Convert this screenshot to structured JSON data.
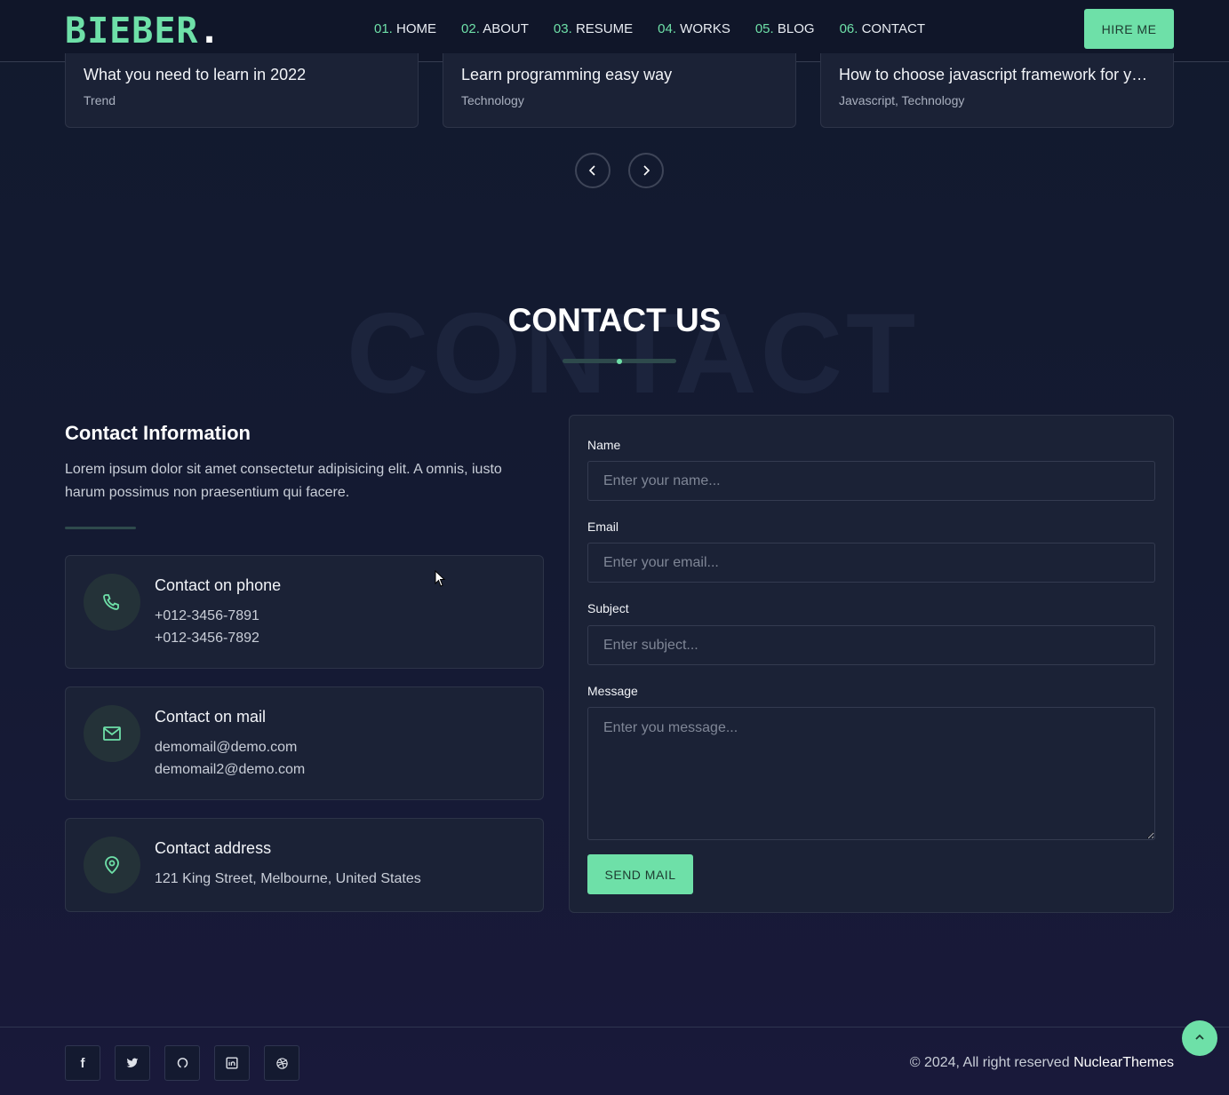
{
  "header": {
    "logo": "BIEBER",
    "logo_dot": ".",
    "nav": [
      {
        "num": "01.",
        "label": "HOME"
      },
      {
        "num": "02.",
        "label": "ABOUT"
      },
      {
        "num": "03.",
        "label": "RESUME"
      },
      {
        "num": "04.",
        "label": "WORKS"
      },
      {
        "num": "05.",
        "label": "BLOG"
      },
      {
        "num": "06.",
        "label": "CONTACT"
      }
    ],
    "hire": "HIRE ME"
  },
  "blog": [
    {
      "title": "What you need to learn in 2022",
      "tags": "Trend"
    },
    {
      "title": "Learn programming easy way",
      "tags": "Technology"
    },
    {
      "title": "How to choose javascript framework for your project",
      "tags": "Javascript,  Technology"
    }
  ],
  "contact": {
    "bg_word": "CONTACT",
    "title": "CONTACT US",
    "info_title": "Contact Information",
    "info_text": "Lorem ipsum dolor sit amet consectetur adipisicing elit. A omnis, iusto harum possimus non praesentium qui facere.",
    "cards": [
      {
        "title": "Contact on phone",
        "lines": [
          "+012-3456-7891",
          "+012-3456-7892"
        ]
      },
      {
        "title": "Contact on mail",
        "lines": [
          "demomail@demo.com",
          "demomail2@demo.com"
        ]
      },
      {
        "title": "Contact address",
        "lines": [
          "121 King Street, Melbourne, United States"
        ]
      }
    ],
    "form": {
      "name_label": "Name",
      "name_ph": "Enter your name...",
      "email_label": "Email",
      "email_ph": "Enter your email...",
      "subject_label": "Subject",
      "subject_ph": "Enter subject...",
      "message_label": "Message",
      "message_ph": "Enter you message...",
      "send": "SEND MAIL"
    }
  },
  "footer": {
    "copy": "© 2024, All right reserved",
    "brand": "NuclearThemes",
    "social": [
      "facebook",
      "twitter",
      "github",
      "linkedin",
      "dribbble"
    ]
  },
  "colors": {
    "accent": "#6ee0a8",
    "card": "#1b2236"
  }
}
